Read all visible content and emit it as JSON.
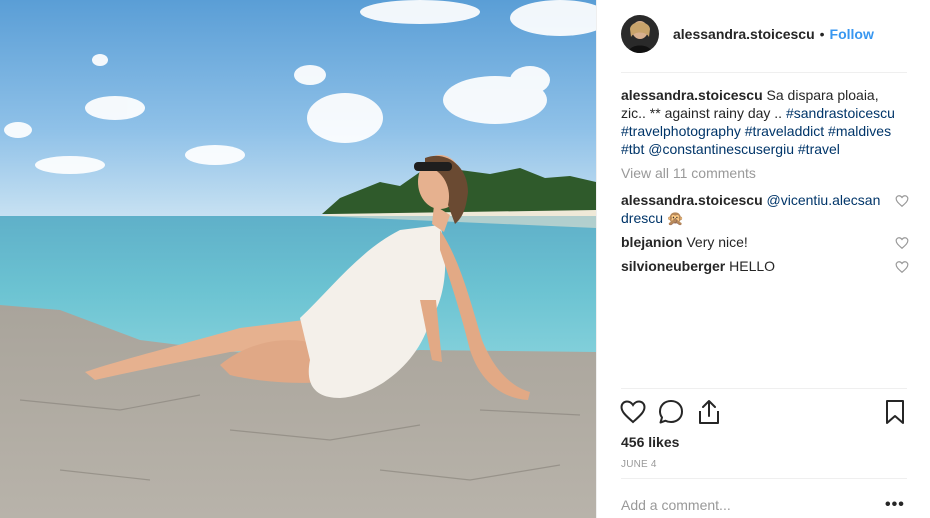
{
  "post": {
    "image_alt": "photo",
    "author": "alessandra.stoicescu",
    "follow_label": "Follow",
    "separator": "•"
  },
  "caption": {
    "username": "alessandra.stoicescu",
    "text": " Sa dispara ploaia, zic.. ** against rainy day .. ",
    "tags": [
      "#sandrastoicescu",
      "#travelphotography",
      "#traveladdict",
      "#maldives",
      "#tbt",
      "@constantinescusergiu",
      "#travel"
    ]
  },
  "view_all_comments": "View all 11 comments",
  "comments": [
    {
      "username": "alessandra.stoicescu",
      "mention": "@vicentiu.alecsandrescu",
      "text": " 🙊"
    },
    {
      "username": "blejanion",
      "mention": "",
      "text": " Very nice!"
    },
    {
      "username": "silvioneuberger",
      "mention": "",
      "text": " HELLO"
    }
  ],
  "actions": {
    "like_icon": "heart-icon",
    "comment_icon": "comment-icon",
    "share_icon": "share-icon",
    "save_icon": "bookmark-icon"
  },
  "likes": "456 likes",
  "date": "JUNE 4",
  "add_comment_placeholder": "Add a comment...",
  "more_label": "•••",
  "colors": {
    "accent": "#3897f0",
    "link": "#003569",
    "muted": "#999999",
    "text": "#262626"
  }
}
